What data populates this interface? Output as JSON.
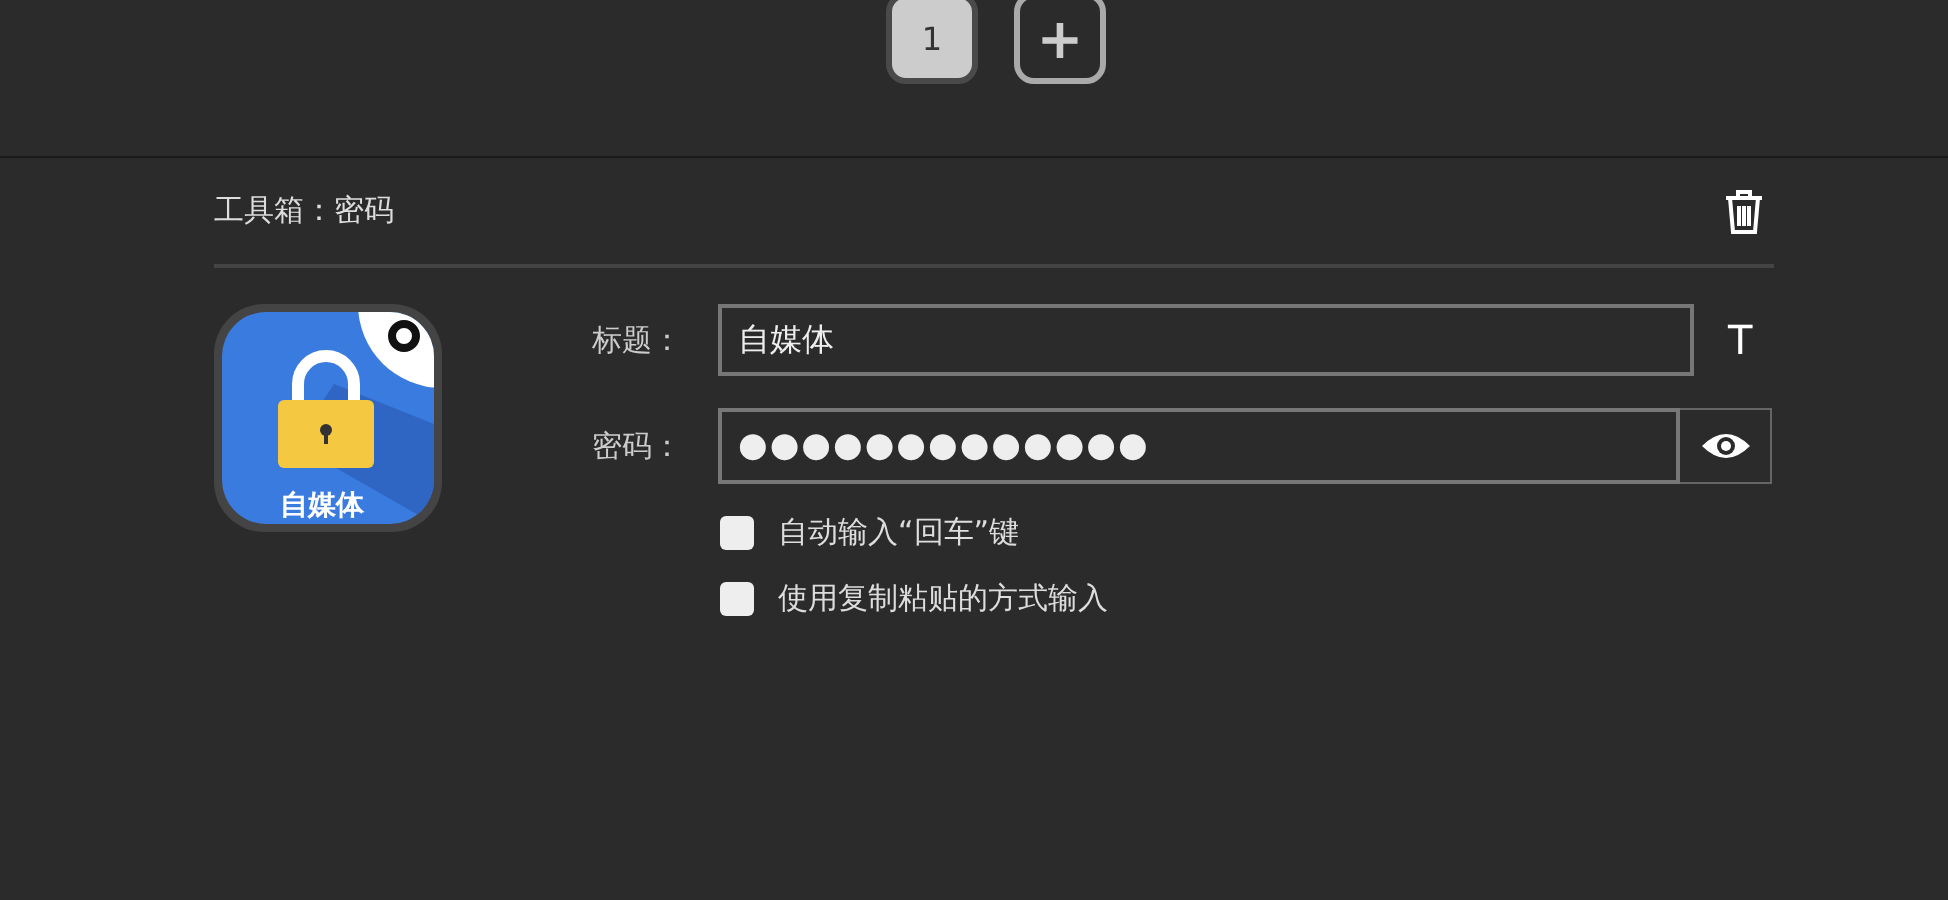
{
  "pages": [
    {
      "label": "1",
      "selected": true
    }
  ],
  "add_page": {
    "label": "+"
  },
  "section": {
    "title": "工具箱：密码"
  },
  "app_icon": {
    "label": "自媒体"
  },
  "fields": [
    {
      "kind": "text",
      "label": "标题：",
      "value": "自媒体",
      "side": "T"
    },
    {
      "kind": "password",
      "label": "密码：",
      "value": "●●●●●●●●●●●●●"
    }
  ],
  "options": [
    {
      "label": "自动输入“回车”键",
      "checked": false
    },
    {
      "label": "使用复制粘贴的方式输入",
      "checked": false
    }
  ]
}
